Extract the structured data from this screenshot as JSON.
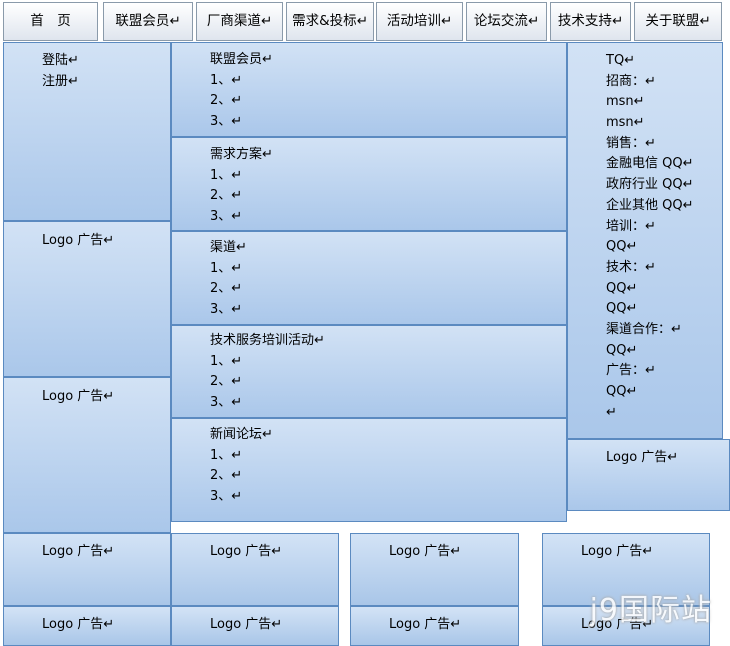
{
  "nav": {
    "tabs": [
      {
        "label": "首　页"
      },
      {
        "label": "联盟会员↵"
      },
      {
        "label": "厂商渠道↵"
      },
      {
        "label": "需求&投标↵"
      },
      {
        "label": "活动培训↵"
      },
      {
        "label": "论坛交流↵"
      },
      {
        "label": "技术支持↵"
      },
      {
        "label": "关于联盟↵"
      }
    ]
  },
  "left": {
    "login": "登陆↵",
    "register": "注册↵",
    "ad1": "Logo 广告↵",
    "ad2": "Logo 广告↵"
  },
  "middle": {
    "sections": [
      {
        "title": "联盟会员↵",
        "items": [
          "1、↵",
          "2、↵",
          "3、↵"
        ]
      },
      {
        "title": "需求方案↵",
        "items": [
          "1、↵",
          "2、↵",
          "3、↵"
        ]
      },
      {
        "title": "渠道↵",
        "items": [
          "1、↵",
          "2、↵",
          "3、↵"
        ]
      },
      {
        "title": "技术服务培训活动↵",
        "items": [
          "1、↵",
          "2、↵",
          "3、↵"
        ]
      },
      {
        "title": "新闻论坛↵",
        "items": [
          "1、↵",
          "2、↵",
          "3、↵"
        ]
      }
    ]
  },
  "right": {
    "contacts": [
      "TQ↵",
      "招商：↵",
      "msn↵",
      "msn↵",
      "销售：↵",
      "金融电信 QQ↵",
      "政府行业 QQ↵",
      "企业其他 QQ↵",
      "培训：↵",
      "QQ↵",
      "技术：↵",
      "QQ↵",
      "QQ↵",
      "渠道合作：↵",
      "QQ↵",
      "广告：↵",
      "QQ↵",
      "↵"
    ],
    "ad": "Logo 广告↵"
  },
  "bottom": {
    "row1": [
      "Logo 广告↵",
      "Logo 广告↵",
      "Logo 广告↵",
      "Logo 广告↵"
    ],
    "row2": [
      "Logo 广告↵",
      "Logo 广告↵",
      "Logo 广告↵",
      "Logo 广告↵"
    ]
  },
  "watermark": "j9国际站"
}
